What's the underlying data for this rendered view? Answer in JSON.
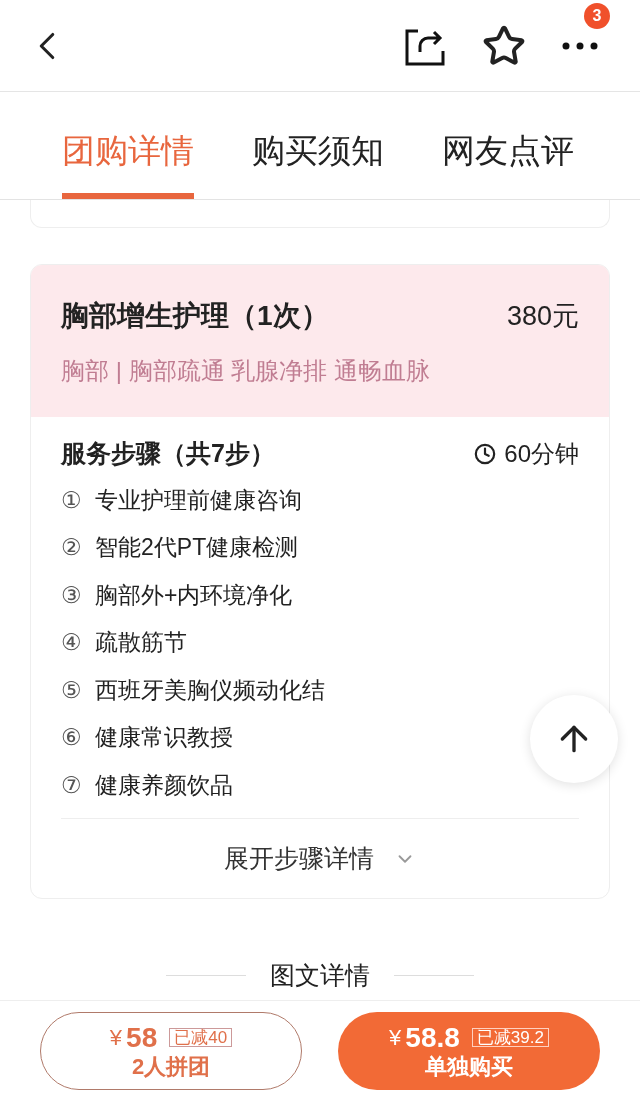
{
  "header": {
    "badge": "3"
  },
  "tabs": [
    {
      "label": "团购详情",
      "selected": true
    },
    {
      "label": "购买须知",
      "selected": false
    },
    {
      "label": "网友点评",
      "selected": false
    }
  ],
  "service": {
    "title": "胸部增生护理（1次）",
    "price": "380元",
    "tags": "胸部 | 胸部疏通 乳腺净排 通畅血脉",
    "steps_title": "服务步骤（共7步）",
    "duration": "60分钟",
    "steps": [
      {
        "marker": "①",
        "text": "专业护理前健康咨询"
      },
      {
        "marker": "②",
        "text": "智能2代PT健康检测"
      },
      {
        "marker": "③",
        "text": "胸部外+内环境净化"
      },
      {
        "marker": "④",
        "text": "疏散筋节"
      },
      {
        "marker": "⑤",
        "text": "西班牙美胸仪频动化结"
      },
      {
        "marker": "⑥",
        "text": "健康常识教授"
      },
      {
        "marker": "⑦",
        "text": "健康养颜饮品"
      }
    ],
    "expand_label": "展开步骤详情"
  },
  "section_heading": "图文详情",
  "buttons": [
    {
      "kind": "outline",
      "price_symbol": "¥",
      "price": "58",
      "discount": "已减40",
      "label": "2人拼团"
    },
    {
      "kind": "filled",
      "price_symbol": "¥",
      "price": "58.8",
      "discount": "已减39.2",
      "label": "单独购买"
    }
  ]
}
